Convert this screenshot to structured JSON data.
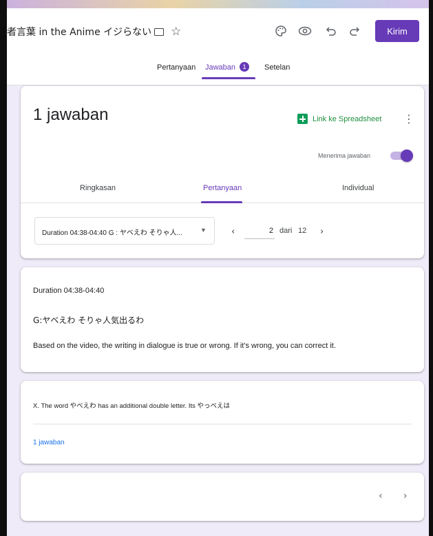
{
  "header": {
    "doc_title": "者言葉 in the Anime イジらない",
    "send_label": "Kirim"
  },
  "icons": {
    "folder": "folder-icon",
    "star": "star-icon",
    "palette": "palette-icon",
    "preview": "eye-icon",
    "undo": "undo-icon",
    "redo": "redo-icon"
  },
  "tabs": [
    {
      "label": "Pertanyaan"
    },
    {
      "label": "Jawaban",
      "badge": "1"
    },
    {
      "label": "Setelan"
    }
  ],
  "summary": {
    "responses_title": "1 jawaban",
    "spreadsheet_link": "Link ke Spreadsheet",
    "accepting_label": "Menerima jawaban",
    "accepting": true
  },
  "subtabs": [
    {
      "label": "Ringkasan"
    },
    {
      "label": "Pertanyaan"
    },
    {
      "label": "Individual"
    }
  ],
  "question_picker": {
    "selected": "Duration 04:38-04:40 G : ヤベえわ そりゃ人...",
    "current_page": "2",
    "of_label": "dari",
    "total_pages": "12"
  },
  "question": {
    "line1": "Duration 04:38-04:40",
    "line2": "G:ヤベえわ そりゃ人気出るわ",
    "line3": "Based on the video, the writing in dialogue is true or wrong. If it's wrong, you can correct it."
  },
  "answer": {
    "text": "X. The word やべえわ has an additional double letter. Its やっべえは",
    "response_count": "1 jawaban"
  },
  "colors": {
    "accent": "#673ab7",
    "page_bg": "#f0ebf8",
    "link": "#1a73e8",
    "sheets_green": "#0f9d58"
  }
}
